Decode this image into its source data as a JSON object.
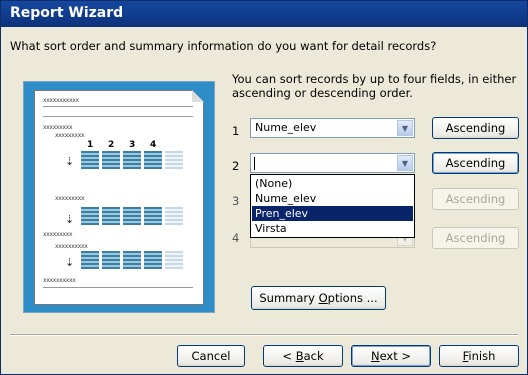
{
  "window": {
    "title": "Report Wizard"
  },
  "question": "What sort order and summary information do you want for detail records?",
  "info": "You can sort records by up to four fields, in either ascending or descending order.",
  "preview": {
    "texts": [
      "xxxxxxxxxxx",
      "xxxxxxxxx",
      "xxxxxxxxx",
      "xxxxxxxxx",
      "xxxxxxxxx",
      "xxxxxxxxxx",
      "xxxxxxxxxx"
    ],
    "column_numbers": [
      "1",
      "2",
      "3",
      "4"
    ]
  },
  "sort_rows": [
    {
      "number": "1",
      "field": "Nume_elev",
      "order": "Ascending",
      "enabled": true
    },
    {
      "number": "2",
      "field": "",
      "order": "Ascending",
      "enabled": true
    },
    {
      "number": "3",
      "field": "",
      "order": "Ascending",
      "enabled": false
    },
    {
      "number": "4",
      "field": "",
      "order": "Ascending",
      "enabled": false
    }
  ],
  "dropdown_options": [
    "(None)",
    "Nume_elev",
    "Pren_elev",
    "Virsta"
  ],
  "dropdown_selected": "Pren_elev",
  "buttons": {
    "summary_prefix": "Summary ",
    "summary_accel": "O",
    "summary_suffix": "ptions ...",
    "cancel": "Cancel",
    "back_prefix": "< ",
    "back_accel": "B",
    "back_suffix": "ack",
    "next_accel": "N",
    "next_suffix": "ext >",
    "finish_accel": "F",
    "finish_suffix": "inish"
  },
  "icons": {
    "dropdown_arrow": "chevron-down-icon",
    "sort_arrows": "az-sort-icon"
  }
}
